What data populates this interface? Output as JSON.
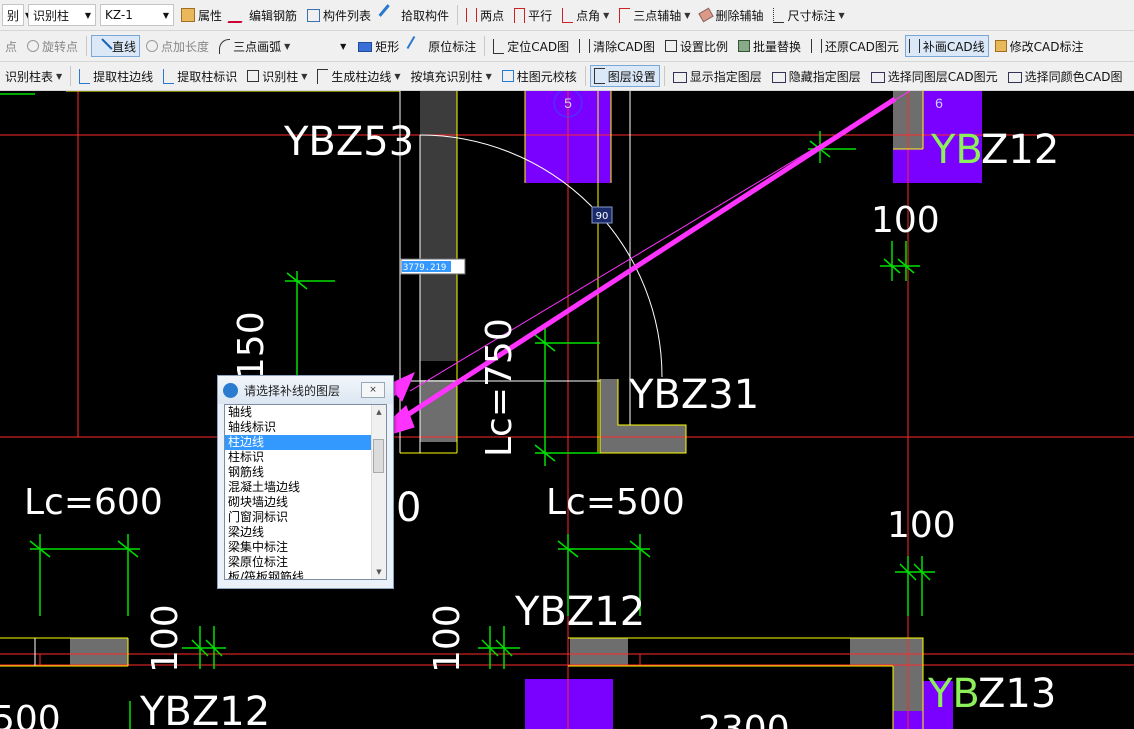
{
  "toolbar1": {
    "combo_partial": "别",
    "combo_type": "识别柱",
    "combo_component": "KZ-1",
    "properties": "属性",
    "edit_rebar": "编辑钢筋",
    "component_list": "构件列表",
    "pick_component": "拾取构件",
    "two_points": "两点",
    "parallel": "平行",
    "point_angle": "点角",
    "three_point_aux": "三点辅轴",
    "delete_aux": "删除辅轴",
    "dimension": "尺寸标注"
  },
  "toolbar2": {
    "point_partial": "点",
    "rotate_point": "旋转点",
    "line": "直线",
    "point_length": "点加长度",
    "three_point_arc": "三点画弧",
    "rectangle": "矩形",
    "in_place_label": "原位标注",
    "locate_cad": "定位CAD图",
    "clear_cad": "清除CAD图",
    "set_scale": "设置比例",
    "batch_replace": "批量替换",
    "restore_cad": "还原CAD图元",
    "supplement_cad_line": "补画CAD线",
    "modify_cad_label": "修改CAD标注"
  },
  "toolbar3": {
    "identify_column_table": "识别柱表",
    "extract_column_edge": "提取柱边线",
    "extract_column_label": "提取柱标识",
    "identify_column": "识别柱",
    "generate_column_edge": "生成柱边线",
    "fill_identify_column": "按填充识别柱",
    "column_check": "柱图元校核",
    "layer_settings": "图层设置",
    "show_layer": "显示指定图层",
    "hide_layer": "隐藏指定图层",
    "select_same_layer": "选择同图层CAD图元",
    "select_same_color": "选择同颜色CAD图"
  },
  "canvas": {
    "labels": {
      "ybz53": "YBZ53",
      "ybz12_top_prefix": "YB",
      "ybz12_top_suffix": "Z12",
      "dim_100_a": "100",
      "dim_1150": "1150",
      "lc_750": "Lc=750",
      "ybz31": "YBZ31",
      "lc_600": "Lc=600",
      "dim_0": "0",
      "lc_500": "Lc=500",
      "dim_100_b": "100",
      "ybz12_mid": "YBZ12",
      "dim_100_c": "100",
      "dim_100_d": "100",
      "ybz13_prefix": "YB",
      "ybz13_suffix": "Z13",
      "dim_500": "500",
      "ybz12_bottom": "YBZ12",
      "dim_2300": "2300",
      "axis_5": "5",
      "axis_6": "6",
      "angle_90": "90",
      "length_input": "3779.219"
    },
    "colors": {
      "axis_red": "#ff2a2a",
      "column_yellow": "#ffff00",
      "purple_fill": "#7a00ff",
      "grey_fill": "#6e6e6e",
      "dim_green": "#00e000",
      "annotation_magenta": "#ff33ff",
      "label_green": "#8cf05a"
    }
  },
  "dialog": {
    "title": "请选择补线的图层",
    "close_label": "⨯",
    "items": [
      "轴线",
      "轴线标识",
      "柱边线",
      "柱标识",
      "钢筋线",
      "混凝土墙边线",
      "砌块墙边线",
      "门窗洞标识",
      "梁边线",
      "梁集中标注",
      "梁原位标注",
      "板/筏板钢筋线"
    ],
    "selected_index": 2
  }
}
